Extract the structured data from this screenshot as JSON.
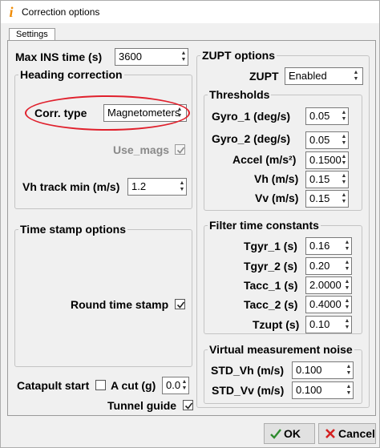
{
  "window": {
    "title": "Correction options",
    "app_icon": "matlab-app-icon"
  },
  "tabs": [
    {
      "label": "Settings"
    }
  ],
  "max_ins": {
    "label": "Max INS time (s)",
    "value": "3600"
  },
  "heading": {
    "title": "Heading correction",
    "corr_type_label": "Corr. type",
    "corr_type_value": "Magnetometers",
    "use_mags_label": "Use_mags",
    "use_mags_checked": true,
    "vh_track_label": "Vh track min (m/s)",
    "vh_track_value": "1.2"
  },
  "timestamp": {
    "title": "Time stamp options",
    "round_label": "Round time stamp",
    "round_checked": true
  },
  "bottom": {
    "catapult_label": "Catapult start",
    "catapult_checked": false,
    "acut_label": "A cut (g)",
    "acut_value": "0.0",
    "tunnel_label": "Tunnel guide",
    "tunnel_checked": true
  },
  "zupt": {
    "title": "ZUPT options",
    "zupt_label": "ZUPT",
    "zupt_value": "Enabled"
  },
  "thresholds": {
    "title": "Thresholds",
    "gyro1_label": "Gyro_1 (deg/s)",
    "gyro1_value": "0.05",
    "gyro2_label": "Gyro_2 (deg/s)",
    "gyro2_value": "0.05",
    "accel_label": "Accel (m/s²)",
    "accel_value": "0.1500",
    "vh_label": "Vh (m/s)",
    "vh_value": "0.15",
    "vv_label": "Vv (m/s)",
    "vv_value": "0.15"
  },
  "filter": {
    "title": "Filter time constants",
    "tgyr1_label": "Tgyr_1 (s)",
    "tgyr1_value": "0.16",
    "tgyr2_label": "Tgyr_2 (s)",
    "tgyr2_value": "0.20",
    "tacc1_label": "Tacc_1 (s)",
    "tacc1_value": "2.0000",
    "tacc2_label": "Tacc_2 (s)",
    "tacc2_value": "0.4000",
    "tzupt_label": "Tzupt (s)",
    "tzupt_value": "0.10"
  },
  "vmn": {
    "title": "Virtual measurement noise",
    "std_vh_label": "STD_Vh (m/s)",
    "std_vh_value": "0.100",
    "std_vv_label": "STD_Vv (m/s)",
    "std_vv_value": "0.100"
  },
  "buttons": {
    "ok_label": "OK",
    "cancel_label": "Cancel"
  },
  "colors": {
    "highlight_ellipse": "#e0202c",
    "ok_check": "#2e8b2e",
    "cancel_x": "#d42020"
  }
}
